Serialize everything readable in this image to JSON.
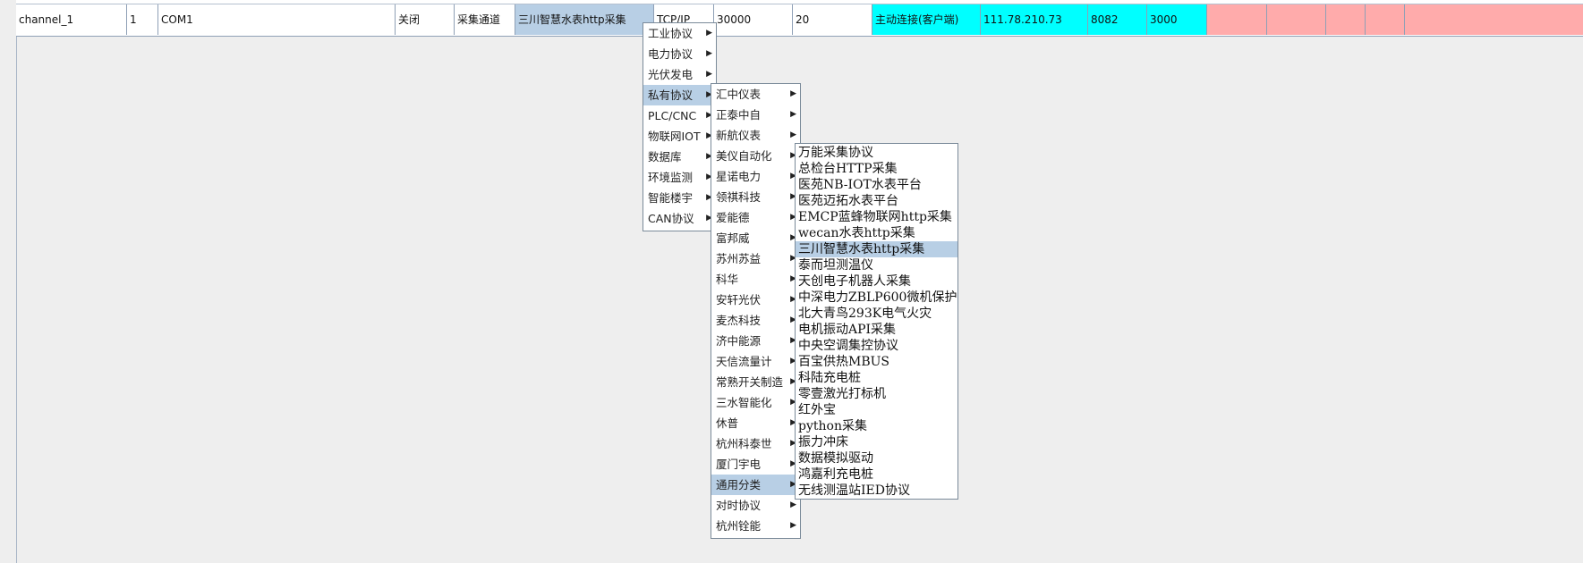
{
  "table": {
    "row": {
      "name": "channel_1",
      "index": "1",
      "port": "COM1",
      "state": "关闭",
      "type": "采集通道",
      "protocol": "三川智慧水表http采集",
      "transport": "TCP/IP",
      "timeout": "30000",
      "retry": "20",
      "mode": "主动连接(客户端)",
      "ip": "111.78.210.73",
      "remote_port": "8082",
      "interval": "3000"
    }
  },
  "colors": {
    "selection": "#b8cfe5",
    "cyan_cell": "#00ffff",
    "pink_cell": "#ffabab",
    "background": "#eeeeee"
  },
  "menu1": {
    "items": [
      {
        "label": "工业协议"
      },
      {
        "label": "电力协议"
      },
      {
        "label": "光伏发电"
      },
      {
        "label": "私有协议"
      },
      {
        "label": "PLC/CNC"
      },
      {
        "label": "物联网IOT"
      },
      {
        "label": "数据库"
      },
      {
        "label": "环境监测"
      },
      {
        "label": "智能楼宇"
      },
      {
        "label": "CAN协议"
      }
    ],
    "highlighted": "私有协议"
  },
  "menu2": {
    "items": [
      {
        "label": "汇中仪表"
      },
      {
        "label": "正泰中自"
      },
      {
        "label": "新航仪表"
      },
      {
        "label": "美仪自动化"
      },
      {
        "label": "星诺电力"
      },
      {
        "label": "领祺科技"
      },
      {
        "label": "爱能德"
      },
      {
        "label": "富邦威"
      },
      {
        "label": "苏州苏益"
      },
      {
        "label": "科华"
      },
      {
        "label": "安轩光伏"
      },
      {
        "label": "麦杰科技"
      },
      {
        "label": "济中能源"
      },
      {
        "label": "天信流量计"
      },
      {
        "label": "常熟开关制造"
      },
      {
        "label": "三水智能化"
      },
      {
        "label": "休普"
      },
      {
        "label": "杭州科泰世"
      },
      {
        "label": "厦门宇电"
      },
      {
        "label": "通用分类"
      },
      {
        "label": "对时协议"
      },
      {
        "label": "杭州铨能"
      }
    ],
    "highlighted": "通用分类"
  },
  "menu3": {
    "items": [
      {
        "label": "万能采集协议"
      },
      {
        "label": "总检台HTTP采集"
      },
      {
        "label": "医苑NB-IOT水表平台"
      },
      {
        "label": "医苑迈拓水表平台"
      },
      {
        "label": "EMCP蓝蜂物联网http采集"
      },
      {
        "label": "wecan水表http采集"
      },
      {
        "label": "三川智慧水表http采集"
      },
      {
        "label": "泰而坦测温仪"
      },
      {
        "label": "天创电子机器人采集"
      },
      {
        "label": "中深电力ZBLP600微机保护"
      },
      {
        "label": "北大青鸟293K电气火灾"
      },
      {
        "label": "电机振动API采集"
      },
      {
        "label": "中央空调集控协议"
      },
      {
        "label": "百宝供热MBUS"
      },
      {
        "label": "科陆充电桩"
      },
      {
        "label": "零壹激光打标机"
      },
      {
        "label": "红外宝"
      },
      {
        "label": "python采集"
      },
      {
        "label": "振力冲床"
      },
      {
        "label": "数据模拟驱动"
      },
      {
        "label": "鸿嘉利充电桩"
      },
      {
        "label": "无线测温站IED协议"
      }
    ],
    "highlighted": "三川智慧水表http采集"
  },
  "icons": {
    "submenu_arrow": "chevron-right-icon"
  }
}
